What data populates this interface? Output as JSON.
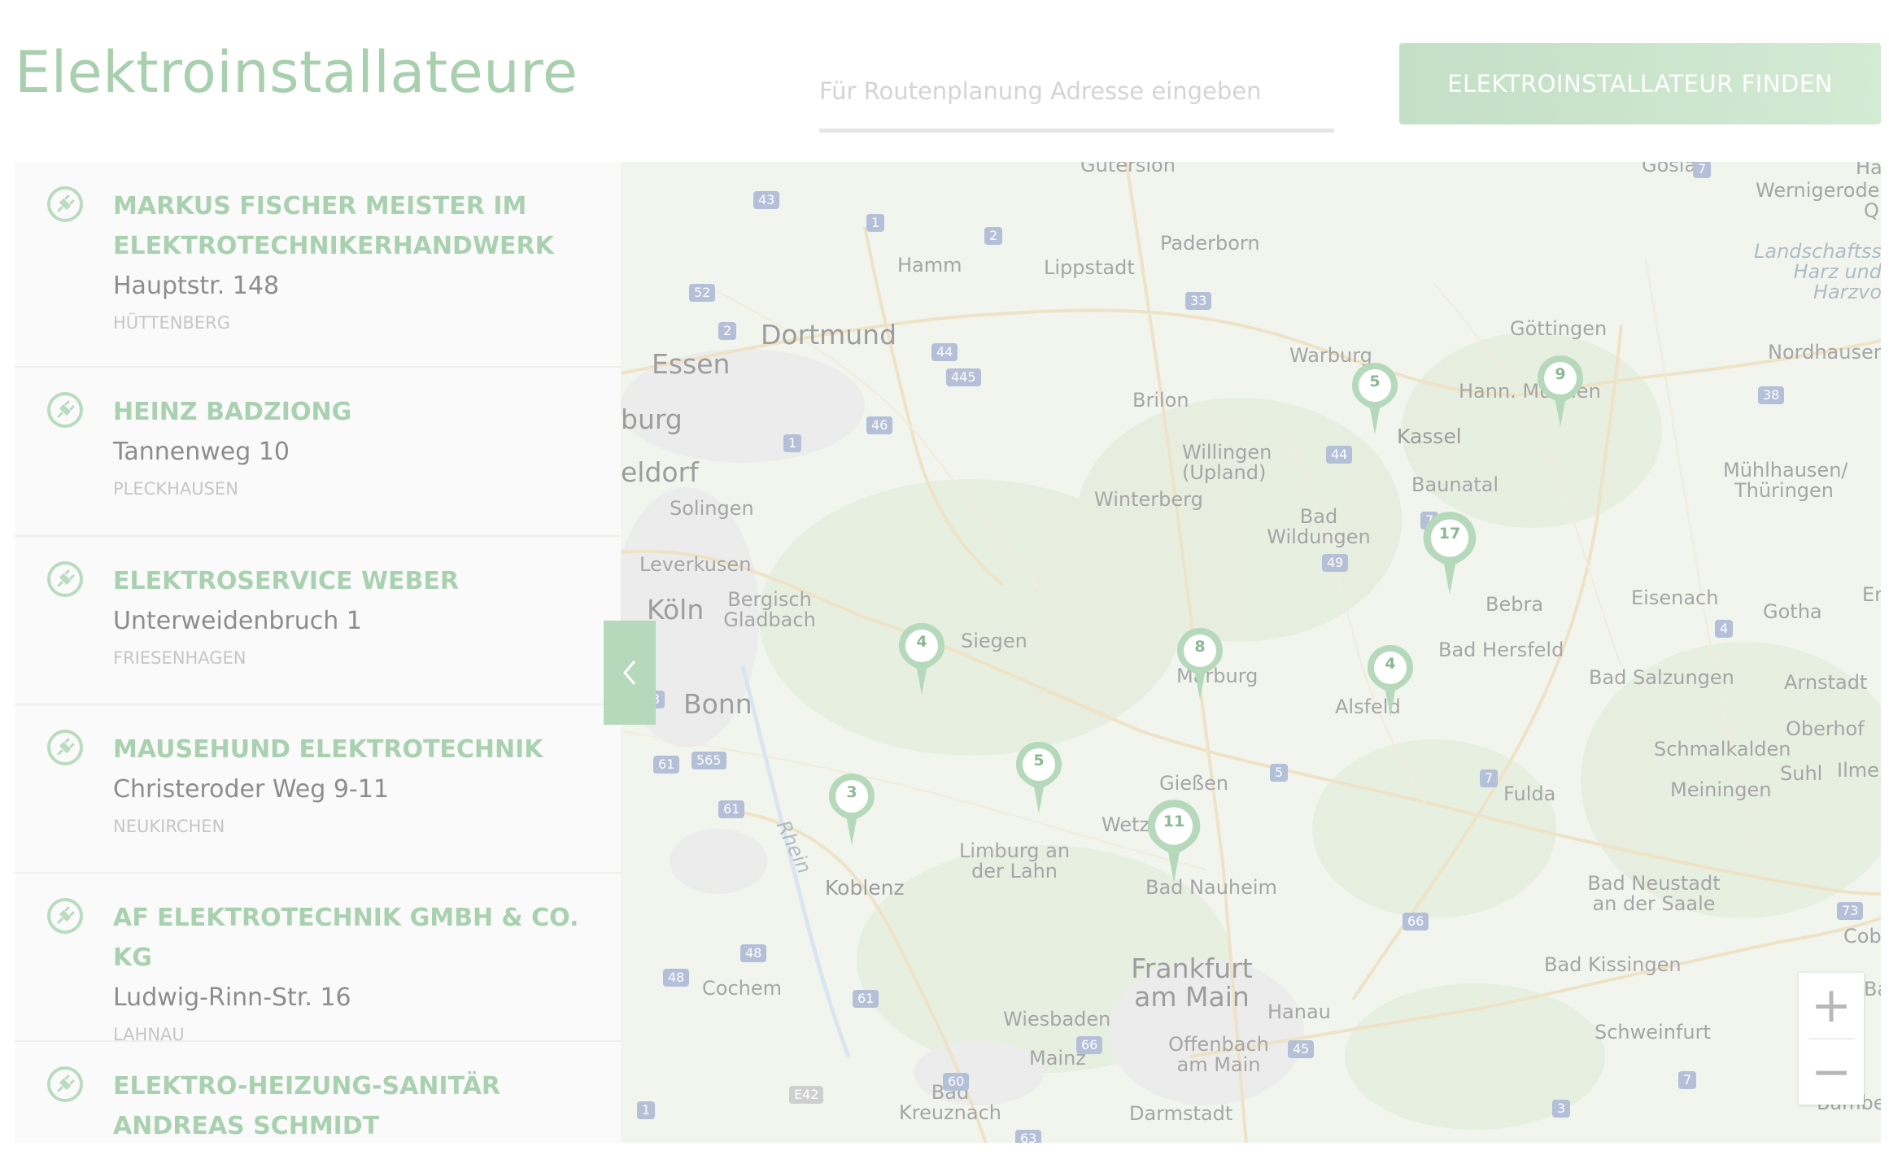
{
  "header": {
    "title": "Elektroinstallateure",
    "search_placeholder": "Für Routenplanung Adresse eingeben",
    "find_button": "ELEKTROINSTALLATEUR FINDEN"
  },
  "installers": [
    {
      "name": "MARKUS FISCHER MEISTER IM ELEKTROTECHNIKERHANDWERK",
      "street": "Hauptstr. 148",
      "city": "HÜTTENBERG"
    },
    {
      "name": "HEINZ BADZIONG",
      "street": "Tannenweg 10",
      "city": "PLECKHAUSEN"
    },
    {
      "name": "ELEKTROSERVICE WEBER",
      "street": "Unterweidenbruch 1",
      "city": "FRIESENHAGEN"
    },
    {
      "name": "MAUSEHUND ELEKTROTECHNIK",
      "street": "Christeroder Weg 9-11",
      "city": "NEUKIRCHEN"
    },
    {
      "name": "AF ELEKTROTECHNIK GMBH & CO. KG",
      "street": "Ludwig-Rinn-Str. 16",
      "city": "LAHNAU"
    },
    {
      "name": "ELEKTRO-HEIZUNG-SANITÄR ANDREAS SCHMIDT",
      "street": "",
      "city": ""
    }
  ],
  "map": {
    "cities": {
      "dortmund": "Dortmund",
      "essen": "Essen",
      "burg": "burg",
      "eldorf": "eldorf",
      "koeln": "Köln",
      "bonn": "Bonn",
      "frankfurt": "Frankfurt am Main",
      "hamm": "Hamm",
      "lippstadt": "Lippstadt",
      "paderborn": "Paderborn",
      "warburg": "Warburg",
      "goettingen": "Göttingen",
      "wernigerode": "Wernigerode",
      "landschaft": "Landschaftss Harz und Harzvo",
      "nordhausen": "Nordhausen",
      "hann_muenden": "Hann. Münden",
      "kassel": "Kassel",
      "brilon": "Brilon",
      "willingen": "Willingen (Upland)",
      "baunatal": "Baunatal",
      "muehlhausen": "Mühlhausen/ Thüringen",
      "solingen": "Solingen",
      "winterberg": "Winterberg",
      "bad_wildungen": "Bad Wildungen",
      "leverkusen": "Leverkusen",
      "bergisch": "Bergisch Gladbach",
      "bebra": "Bebra",
      "eisenach": "Eisenach",
      "gotha": "Gotha",
      "er": "Er",
      "siegen": "Siegen",
      "marburg": "Marburg",
      "alsfeld": "Alsfeld",
      "bad_hersfeld": "Bad Hersfeld",
      "bad_salzungen": "Bad Salzungen",
      "arnstadt": "Arnstadt",
      "oberhof": "Oberhof",
      "schmalkalden": "Schmalkalden",
      "suhl": "Suhl",
      "ilmenau": "Ilmena",
      "giessen": "Gießen",
      "fulda": "Fulda",
      "meiningen": "Meiningen",
      "wetz": "Wetz",
      "limburg": "Limburg an der Lahn",
      "koblenz": "Koblenz",
      "bad_nauheim": "Bad Nauheim",
      "bad_neustadt": "Bad Neustadt an der Saale",
      "cobu": "Cobu",
      "cochem": "Cochem",
      "bad_kissingen": "Bad Kissingen",
      "hanau": "Hanau",
      "wiesbaden": "Wiesbaden",
      "mainz": "Mainz",
      "offenbach": "Offenbach am Main",
      "schweinfurt": "Schweinfurt",
      "bad_kreuznach": "Bad Kreuznach",
      "darmstadt": "Darmstadt",
      "bamber": "Bamber",
      "rhein": "Rhein",
      "hal": "Hal",
      "q": "Q",
      "gutersloh": "Gütersloh",
      "goslar": "Goslar",
      "ba": "Ba"
    },
    "roads": [
      "43",
      "1",
      "2",
      "52",
      "2",
      "33",
      "44",
      "445",
      "46",
      "1",
      "61",
      "565",
      "61",
      "48",
      "61",
      "48",
      "1",
      "60",
      "66",
      "45",
      "5",
      "7",
      "49",
      "44",
      "7",
      "3",
      "66",
      "7",
      "73",
      "38",
      "7",
      "4",
      "3",
      "E42",
      "63"
    ],
    "clusters": [
      {
        "count": "4"
      },
      {
        "count": "5"
      },
      {
        "count": "3"
      },
      {
        "count": "8"
      },
      {
        "count": "11"
      },
      {
        "count": "5"
      },
      {
        "count": "17"
      },
      {
        "count": "4"
      },
      {
        "count": "9"
      }
    ],
    "zoom_in": "+",
    "zoom_out": "−"
  },
  "colors": {
    "accent": "#a9d1b0",
    "button_gradient_start": "#c3dfc6",
    "button_gradient_end": "#d3ead3",
    "map_background": "#f1f5ee",
    "marker": "#b6d9bb"
  }
}
